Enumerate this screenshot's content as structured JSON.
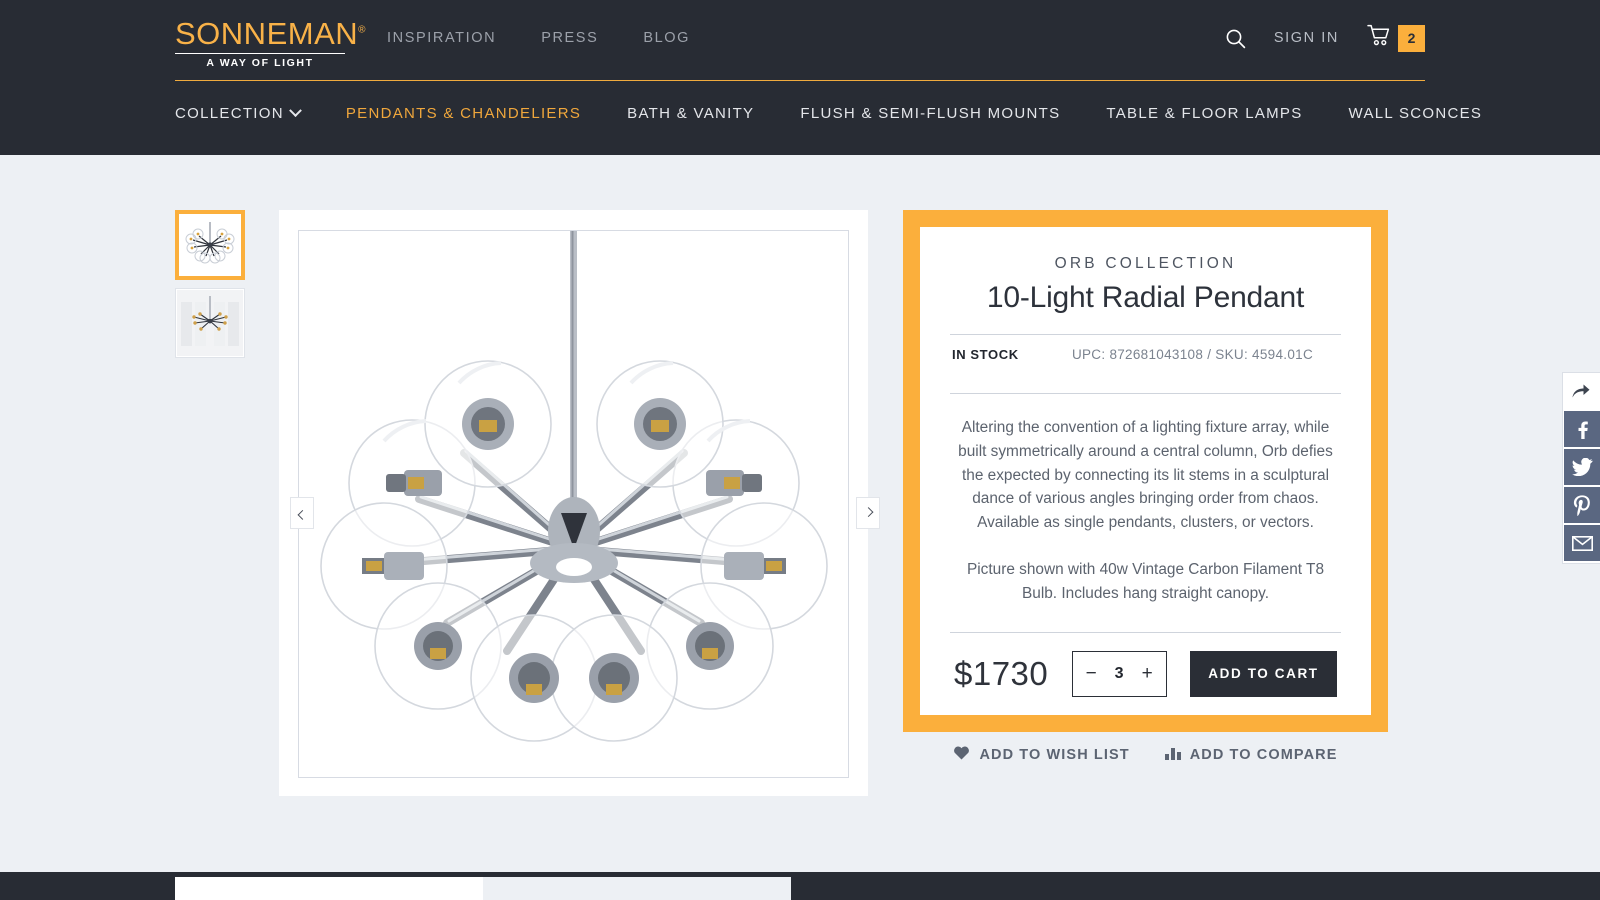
{
  "header": {
    "logo": {
      "word": "SONNEMAN",
      "tm": "®",
      "tagline": "A WAY OF LIGHT"
    },
    "top_links": [
      {
        "label": "INSPIRATION",
        "name": "inspiration"
      },
      {
        "label": "PRESS",
        "name": "press"
      },
      {
        "label": "BLOG",
        "name": "blog"
      }
    ],
    "search_icon": "search-icon",
    "sign_in": "SIGN IN",
    "cart_icon": "shopping-cart-icon",
    "cart_count": "2",
    "accent_color": "#fbaf3c",
    "bar_color": "#282c34",
    "nav": [
      {
        "label": "COLLECTION",
        "name": "collection",
        "has_chevron": true,
        "active": false
      },
      {
        "label": "PENDANTS & CHANDELIERS",
        "name": "pendants-chandeliers",
        "has_chevron": false,
        "active": true
      },
      {
        "label": "BATH & VANITY",
        "name": "bath-vanity",
        "has_chevron": false,
        "active": false
      },
      {
        "label": "FLUSH & SEMI-FLUSH MOUNTS",
        "name": "flush-semi-flush-mounts",
        "has_chevron": false,
        "active": false
      },
      {
        "label": "TABLE & FLOOR LAMPS",
        "name": "table-floor-lamps",
        "has_chevron": false,
        "active": false
      },
      {
        "label": "WALL SCONCES",
        "name": "wall-sconces",
        "has_chevron": false,
        "active": false
      }
    ]
  },
  "gallery": {
    "thumbnails": [
      {
        "name": "thumbnail-1",
        "selected": true,
        "alt": "10-light radial pendant on white"
      },
      {
        "name": "thumbnail-2",
        "selected": false,
        "alt": "10-light radial pendant in room"
      }
    ],
    "prev_icon": "chevron-left-icon",
    "next_icon": "chevron-right-icon",
    "main_image_alt": "10-Light Radial Pendant chrome chandelier with clear glass globes"
  },
  "product": {
    "collection": "ORB COLLECTION",
    "title": "10-Light Radial Pendant",
    "stock_status": "IN STOCK",
    "upc_sku": "UPC: 872681043108 / SKU: 4594.01C",
    "description_paragraphs": [
      "Altering the convention of a lighting fixture array, while built symmetrically around a central column, Orb defies the expected by connecting its lit stems in a sculptural dance of various angles bringing order from chaos. Available as single pendants, clusters, or vectors.",
      "Picture shown with 40w Vintage Carbon Filament T8 Bulb. Includes hang straight canopy."
    ],
    "price": "$1730",
    "qty_decrement": "−",
    "qty_value": "3",
    "qty_increment": "+",
    "add_to_cart": "ADD TO CART",
    "wish_list": "ADD TO WISH LIST",
    "wish_list_icon": "heart-icon",
    "compare": "ADD TO COMPARE",
    "compare_icon": "bar-chart-icon"
  },
  "social": {
    "items": [
      {
        "name": "share-icon",
        "label": "Share"
      },
      {
        "name": "facebook-icon",
        "label": "Facebook"
      },
      {
        "name": "twitter-icon",
        "label": "Twitter"
      },
      {
        "name": "pinterest-icon",
        "label": "Pinterest"
      },
      {
        "name": "email-icon",
        "label": "Email"
      }
    ],
    "color": "#5a6781"
  }
}
